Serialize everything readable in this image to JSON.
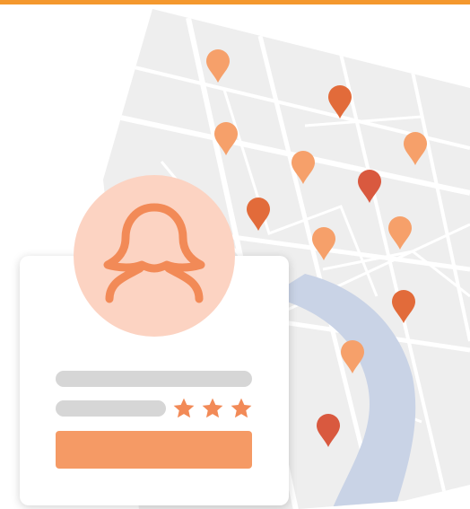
{
  "colors": {
    "accent": "#f4982e",
    "map_background": "#eeeeee",
    "map_street": "#ffffff",
    "river": "#c9d3e6",
    "pin_light": "#f6a06a",
    "pin_medium": "#e26b3a",
    "pin_dark": "#d9593f",
    "avatar_background": "#fcd3c2",
    "avatar_stroke": "#f28a57",
    "star": "#f28a57",
    "button": "#f59a65"
  },
  "icons": {
    "avatar": "person-silhouette-icon",
    "pin": "map-pin-icon",
    "star": "star-icon"
  },
  "rating": {
    "stars_filled": 3,
    "stars_total": 3
  }
}
